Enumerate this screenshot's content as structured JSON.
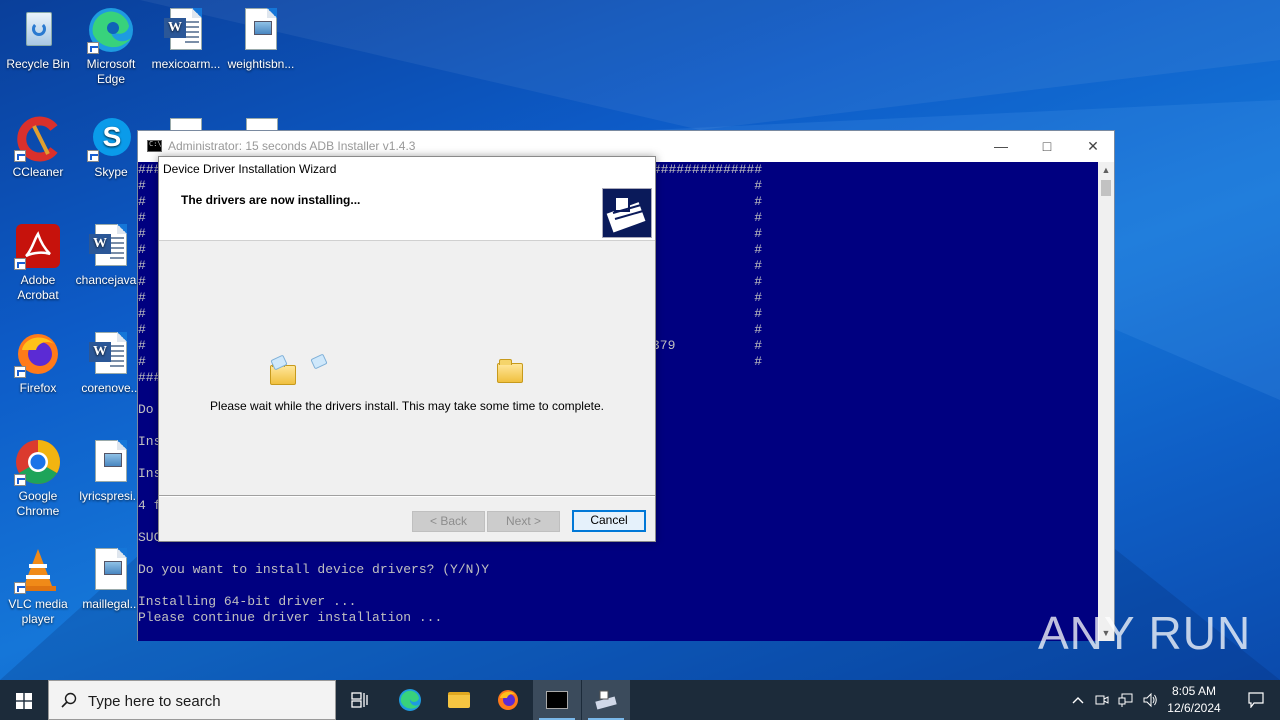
{
  "desktop": {
    "icons": [
      {
        "label": "Recycle Bin"
      },
      {
        "label": "Microsoft Edge"
      },
      {
        "label": "mexicoarm..."
      },
      {
        "label": "weightisbn..."
      },
      {
        "label": "CCleaner"
      },
      {
        "label": "Skype"
      },
      {
        "label": "Adobe Acrobat"
      },
      {
        "label": "chancejava..."
      },
      {
        "label": "Firefox"
      },
      {
        "label": "corenove..."
      },
      {
        "label": "Google Chrome"
      },
      {
        "label": "lyricspresi..."
      },
      {
        "label": "VLC media player"
      },
      {
        "label": "maillegal..."
      }
    ]
  },
  "console": {
    "title": "Administrator:  15 seconds ADB Installer v1.4.3",
    "lines": [
      "################################################################################",
      "#                                                                              #",
      "#",
      "#",
      "#",
      "#",
      "#",
      "#",
      "#",
      "#",
      "#",
      "#",
      "#",
      "###",
      "",
      "Do",
      "",
      "Ins",
      "",
      "Ins",
      "",
      "4 f",
      "",
      "SUC",
      "",
      "Do you want to install device drivers? (Y/N)Y",
      "",
      "Installing 64-bit driver ...",
      "Please continue driver installation ..."
    ],
    "right_fragment": "379"
  },
  "wizard": {
    "title": "Device Driver Installation Wizard",
    "heading": "The drivers are now installing...",
    "message": "Please wait while the drivers install. This may take some time to complete.",
    "back_label": "< Back",
    "next_label": "Next >",
    "cancel_label": "Cancel"
  },
  "taskbar": {
    "search_placeholder": "Type here to search",
    "time": "8:05 AM",
    "date": "12/6/2024"
  },
  "watermark": "ANY RUN"
}
